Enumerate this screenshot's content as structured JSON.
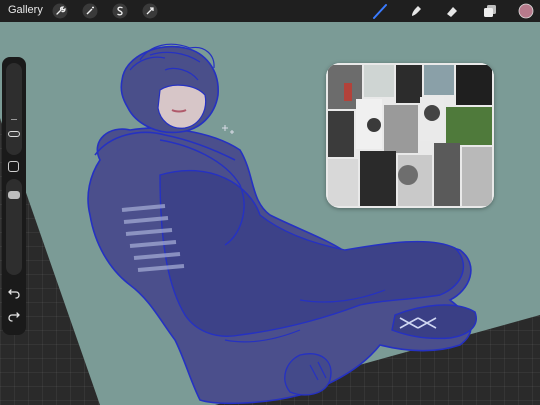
{
  "app": {
    "gallery_label": "Gallery"
  },
  "toolbar": {
    "left_tools": [
      "wrench-icon",
      "magic-wand-icon",
      "selection-icon",
      "transform-arrow-icon"
    ],
    "right_tools": [
      "brush-icon",
      "smudge-icon",
      "eraser-icon",
      "layers-icon",
      "color-swatch"
    ],
    "active_tool": "brush-icon",
    "active_color": "#b77a8c",
    "accent_color": "#3a7bff"
  },
  "sidebar": {
    "items": [
      "brush-size-slider",
      "modify-button",
      "opacity-slider",
      "undo-icon",
      "redo-icon"
    ]
  },
  "canvas": {
    "background_color": "#7a9a95",
    "sketch_color": "#2a33c8"
  },
  "reference": {
    "description_hidden": true
  }
}
